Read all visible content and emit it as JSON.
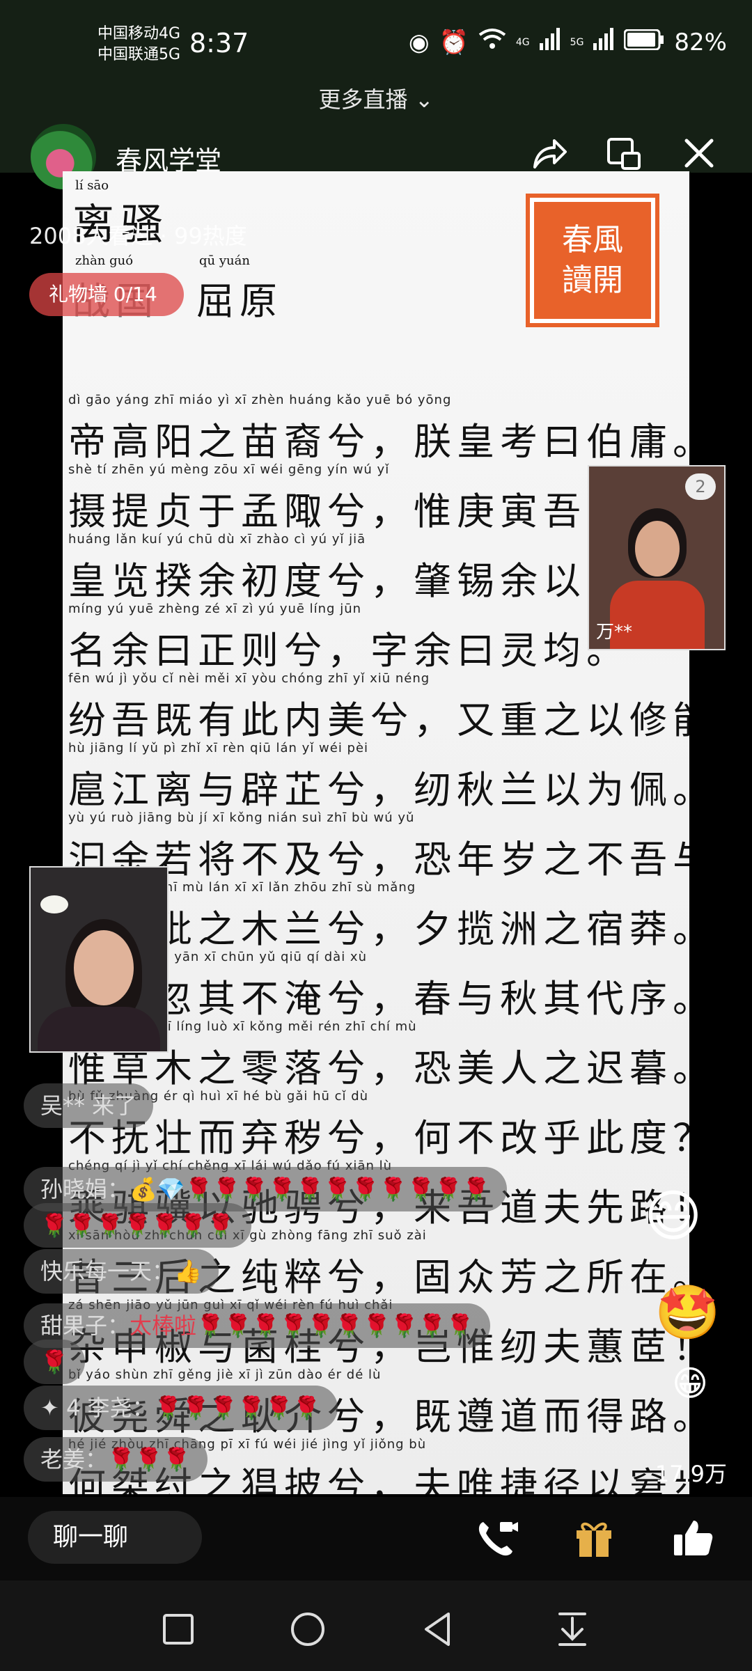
{
  "status_bar": {
    "carrier1": "中国移动4G",
    "carrier2": "中国联通5G",
    "time": "8:37",
    "net1": "4G",
    "net2": "5G",
    "battery": "82%"
  },
  "top": {
    "more_live": "更多直播",
    "host_name": "春风学堂",
    "views": "2008人看过 · 99热度",
    "gift_wall": "礼物墙 0/14"
  },
  "poem": {
    "title": "离骚",
    "title_py": "lí sāo",
    "author": "屈原",
    "author_py": "qū yuán",
    "dynasty": "战国",
    "dynasty_py": "zhàn guó",
    "seal": "春風讀開",
    "lines": [
      {
        "py": "dì gāo yáng zhī miáo yì xī    zhèn huáng kǎo yuē bó yōng",
        "hz": "帝高阳之苗裔兮，朕皇考曰伯庸。"
      },
      {
        "py": "shè tí zhēn yú mèng zōu xī    wéi gēng yín wú yǐ",
        "hz": "摄提贞于孟陬兮，惟庚寅吾以"
      },
      {
        "py": "huáng lǎn kuí yú chū dù xī    zhào cì yú yǐ jiā",
        "hz": "皇览揆余初度兮，肇锡余以嘉"
      },
      {
        "py": "míng yú yuē zhèng zé xī    zì yú yuē líng jūn",
        "hz": "名余曰正则兮，字余曰灵均。"
      },
      {
        "py": "fēn wú jì yǒu cǐ nèi měi xī    yòu chóng zhī yǐ xiū néng",
        "hz": "纷吾既有此内美兮，又重之以修能。"
      },
      {
        "py": "hù jiāng lí yǔ pì zhǐ xī    rèn qiū lán yǐ wéi pèi",
        "hz": "扈江离与辟芷兮，纫秋兰以为佩。"
      },
      {
        "py": "yù yú ruò jiāng bù jí xī    kǒng nián suì zhī bù wú yǔ",
        "hz": "汩余若将不及兮，恐年岁之不吾与。"
      },
      {
        "py": "zhāo qiān pí zhī mù lán xī    xī lǎn zhōu zhī sù mǎng",
        "hz": "朝搴阰之木兰兮，夕揽洲之宿莽。"
      },
      {
        "py": "rì yuè hū qí bù yān xī    chūn yǔ qiū qí dài xù",
        "hz": "日月忽其不淹兮，春与秋其代序。"
      },
      {
        "py": "wéi cǎo mù zhī líng luò xī    kǒng měi rén zhī chí mù",
        "hz": "惟草木之零落兮，恐美人之迟暮。"
      },
      {
        "py": "bù fǔ zhuàng ér qì huì xī    hé bù gǎi hū cǐ dù",
        "hz": "不抚壮而弃秽兮，何不改乎此度？"
      },
      {
        "py": "chéng qí jì yǐ chí chěng xī    lái wú dǎo fú xiān lù",
        "hz": "乘骐骥以驰骋兮，来吾道夫先路！"
      },
      {
        "py": "xī sān hòu zhī chún cuì xī    gù zhòng fāng zhī suǒ zài",
        "hz": "昔三后之纯粹兮，固众芳之所在。"
      },
      {
        "py": "zá shēn jiāo yǔ jūn guì xī    qǐ wéi rèn fú huì chǎi",
        "hz": "杂申椒与菌桂兮，岂惟纫夫蕙茝！"
      },
      {
        "py": "bǐ yáo shùn zhī gěng jiè xī    jì zūn dào ér dé lù",
        "hz": "彼尧舜之耿介兮，既遵道而得路。"
      },
      {
        "py": "hé jié zhòu zhī chāng pī xī    fú wéi jié jìng yǐ jiǒng bù",
        "hz": "何桀纣之猖披兮，夫唯捷径以窘步"
      }
    ]
  },
  "pip_guest": {
    "name": "万**",
    "badge": "2"
  },
  "comments": [
    {
      "user": "吴** 来了",
      "text": ""
    },
    {
      "user": "孙晓娟：",
      "text": "💰💎🌹🌹🌹🌹🌹🌹🌹🌹🌹🌹🌹"
    },
    {
      "user": "",
      "text": "🌹🌹🌹🌹🌹🌹🌹"
    },
    {
      "user": "快乐每一天：",
      "text": "👍"
    },
    {
      "user": "甜果子：",
      "text": "太棒啦🌹🌹🌹🌹🌹🌹🌹🌹🌹🌹"
    },
    {
      "user": "",
      "text": "🌹"
    },
    {
      "user": "✦ 4  李尧：",
      "text": "🌹🌹🌹🌹🌹🌹"
    },
    {
      "user": "老姜：",
      "text": "🌹🌹🌹"
    }
  ],
  "likes_count": "17.9万",
  "toolbar": {
    "chat_label": "聊一聊"
  },
  "icons": {
    "share": "share-icon",
    "pip": "pip-icon",
    "close": "close-icon",
    "call": "video-call-icon",
    "gift": "gift-icon",
    "like": "thumbs-up-icon"
  },
  "colors": {
    "seal": "#e8622a",
    "gift_wall_bg": "#dc4646",
    "flower": "#e23d4d"
  }
}
